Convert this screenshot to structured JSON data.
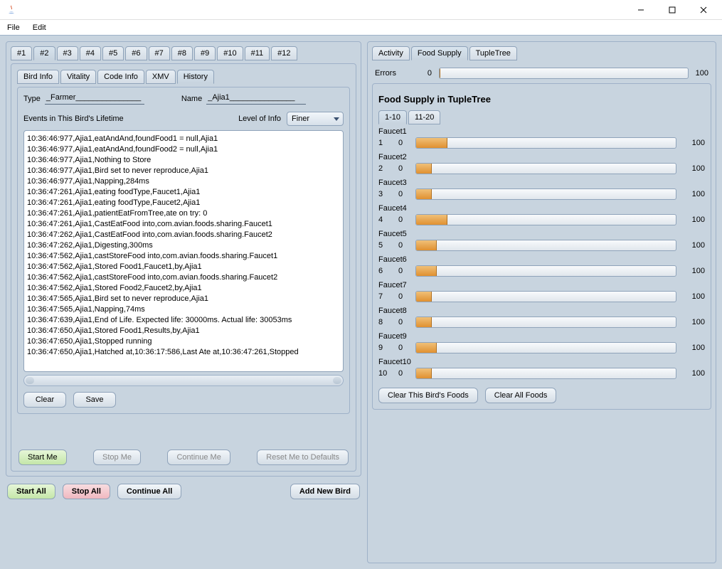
{
  "menu": {
    "file": "File",
    "edit": "Edit"
  },
  "birdTabs": [
    "#1",
    "#2",
    "#3",
    "#4",
    "#5",
    "#6",
    "#7",
    "#8",
    "#9",
    "#10",
    "#11",
    "#12"
  ],
  "infoTabs": [
    "Bird Info",
    "Vitality",
    "Code Info",
    "XMV",
    "History"
  ],
  "typeLabel": "Type",
  "typeValue": "_Farmer_______________",
  "nameLabel": "Name",
  "nameValue": "_Ajia1_______________",
  "eventsLabel": "Events in This Bird's Lifetime",
  "levelLabel": "Level of Info",
  "levelValue": "Finer",
  "events": [
    "10:36:46:977,Ajia1,eatAndAnd,foundFood1 = null,Ajia1",
    "10:36:46:977,Ajia1,eatAndAnd,foundFood2 = null,Ajia1",
    "10:36:46:977,Ajia1,Nothing to Store",
    "10:36:46:977,Ajia1,Bird set to never reproduce,Ajia1",
    "10:36:46:977,Ajia1,Napping,284ms",
    "10:36:47:261,Ajia1,eating foodType,Faucet1,Ajia1",
    "10:36:47:261,Ajia1,eating foodType,Faucet2,Ajia1",
    "10:36:47:261,Ajia1,patientEatFromTree,ate on try: 0",
    "10:36:47:261,Ajia1,CastEatFood into,com.avian.foods.sharing.Faucet1",
    "10:36:47:262,Ajia1,CastEatFood into,com.avian.foods.sharing.Faucet2",
    "10:36:47:262,Ajia1,Digesting,300ms",
    "10:36:47:562,Ajia1,castStoreFood into,com.avian.foods.sharing.Faucet1",
    "10:36:47:562,Ajia1,Stored Food1,Faucet1,by,Ajia1",
    "10:36:47:562,Ajia1,castStoreFood into,com.avian.foods.sharing.Faucet2",
    "10:36:47:562,Ajia1,Stored Food2,Faucet2,by,Ajia1",
    "10:36:47:565,Ajia1,Bird set to never reproduce,Ajia1",
    "10:36:47:565,Ajia1,Napping,74ms",
    "10:36:47:639,Ajia1,End of Life. Expected life: 30000ms. Actual life: 30053ms",
    "10:36:47:650,Ajia1,Stored Food1,Results,by,Ajia1",
    "10:36:47:650,Ajia1,Stopped running",
    "10:36:47:650,Ajia1,Hatched at,10:36:17:586,Last Ate at,10:36:47:261,Stopped"
  ],
  "clearBtn": "Clear",
  "saveBtn": "Save",
  "meButtons": {
    "start": "Start Me",
    "stop": "Stop Me",
    "continue": "Continue Me",
    "reset": "Reset Me to Defaults"
  },
  "allButtons": {
    "start": "Start All",
    "stop": "Stop All",
    "continue": "Continue All",
    "add": "Add New Bird"
  },
  "rightTabs": [
    "Activity",
    "Food Supply",
    "TupleTree"
  ],
  "errorsLabel": "Errors",
  "errorsMin": "0",
  "errorsMax": "100",
  "foodTitle": "Food Supply in TupleTree",
  "rangeTabs": [
    "1-10",
    "11-20"
  ],
  "faucets": [
    {
      "label": "Faucet1",
      "idx": "1",
      "min": "0",
      "max": "100",
      "pct": 12
    },
    {
      "label": "Faucet2",
      "idx": "2",
      "min": "0",
      "max": "100",
      "pct": 6
    },
    {
      "label": "Faucet3",
      "idx": "3",
      "min": "0",
      "max": "100",
      "pct": 6
    },
    {
      "label": "Faucet4",
      "idx": "4",
      "min": "0",
      "max": "100",
      "pct": 12
    },
    {
      "label": "Faucet5",
      "idx": "5",
      "min": "0",
      "max": "100",
      "pct": 8
    },
    {
      "label": "Faucet6",
      "idx": "6",
      "min": "0",
      "max": "100",
      "pct": 8
    },
    {
      "label": "Faucet7",
      "idx": "7",
      "min": "0",
      "max": "100",
      "pct": 6
    },
    {
      "label": "Faucet8",
      "idx": "8",
      "min": "0",
      "max": "100",
      "pct": 6
    },
    {
      "label": "Faucet9",
      "idx": "9",
      "min": "0",
      "max": "100",
      "pct": 8
    },
    {
      "label": "Faucet10",
      "idx": "10",
      "min": "0",
      "max": "100",
      "pct": 6
    }
  ],
  "clearBirdFoods": "Clear This Bird's Foods",
  "clearAllFoods": "Clear All Foods"
}
